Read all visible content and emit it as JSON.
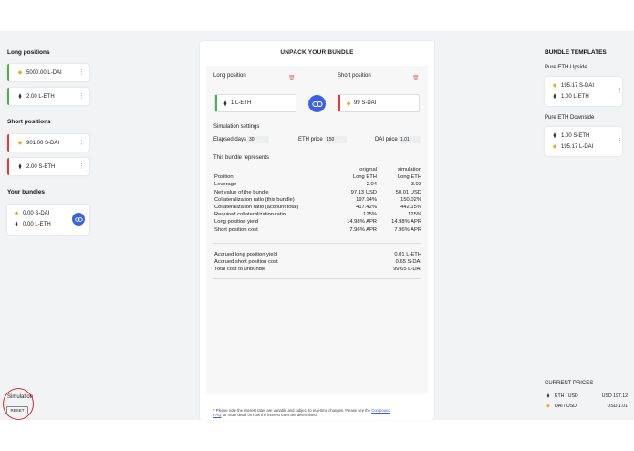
{
  "left": {
    "long_title": "Long positions",
    "long_items": [
      {
        "icon": "dai-icon",
        "text": "5000.00  L-DAI"
      },
      {
        "icon": "eth-icon",
        "text": "2.00  L-ETH"
      }
    ],
    "short_title": "Short positions",
    "short_items": [
      {
        "icon": "dai-icon",
        "text": "901.00  S-DAI"
      },
      {
        "icon": "eth-icon",
        "text": "2.00  S-ETH"
      }
    ],
    "bundles_title": "Your bundles",
    "bundle": {
      "row1": "0.00  S-DAI",
      "row2": "0.00  L-ETH"
    },
    "simulation_label": "Simulation",
    "reset_label": "RESET"
  },
  "main": {
    "title": "UNPACK YOUR BUNDLE",
    "long_label": "Long position",
    "short_label": "Short position",
    "long_value": "1  L-ETH",
    "short_value": "99  S-DAI",
    "sim_settings_label": "Simulation settings",
    "elapsed_label": "Elapsed days",
    "elapsed_value": "30",
    "eth_price_label": "ETH price",
    "eth_price_value": "150",
    "dai_price_label": "DAI price",
    "dai_price_value": "1.01",
    "represents_label": "This bundle represents",
    "table_header": {
      "c1": "original",
      "c2": "simulation"
    },
    "rows": [
      {
        "label": "Position",
        "orig": "Long ETH",
        "sim": "Long ETH"
      },
      {
        "label": "Leverage",
        "orig": "2.04",
        "sim": "3.03"
      },
      {
        "label": "Net value of the bundle",
        "orig": "97.13 USD",
        "sim": "50.01 USD"
      },
      {
        "label": "Collateralization ratio (this bundle)",
        "orig": "197.14%",
        "sim": "150.02%"
      },
      {
        "label": "Collateralization ratio (account total)",
        "orig": "417.42%",
        "sim": "442.15%"
      },
      {
        "label": "Required collateralization ratio",
        "orig": "125%",
        "sim": "125%"
      },
      {
        "label": "Long position yield",
        "orig": "14.98% APR",
        "sim": "14.98% APR"
      },
      {
        "label": "Short position cost",
        "orig": "7.96% APR",
        "sim": "7.96% APR"
      }
    ],
    "totals": [
      {
        "label": "Accrued long position yield",
        "value": "0.01 L-ETH"
      },
      {
        "label": "Accrued short position cost",
        "value": "0.65 S-DAI"
      },
      {
        "label": "Total cost to unbundle",
        "value": "99.65 L-DAI"
      }
    ],
    "footnote_a": "* Please note the interest rates are variable and subject to real-time changes. Please see the",
    "footnote_link": "Compound FAQ",
    "footnote_b": "for more detail on how the interest rates are determined."
  },
  "right": {
    "templates_title": "BUNDLE TEMPLATES",
    "tmpl1_title": "Pure ETH Upside",
    "tmpl1_row1": "195.17  S-DAI",
    "tmpl1_row2": "1.00  L-ETH",
    "tmpl2_title": "Pure ETH Downside",
    "tmpl2_row1": "1.00  S-ETH",
    "tmpl2_row2": "195.17  L-DAI",
    "prices_title": "CURRENT PRICES",
    "prices": [
      {
        "name": "ETH / USD",
        "value": "USD 197.12"
      },
      {
        "name": "DAI / USD",
        "value": "USD 1.01"
      }
    ]
  },
  "colors": {
    "accent": "#3d62e0",
    "long": "#4caf50",
    "short": "#e53935",
    "dai": "#f5a623"
  }
}
